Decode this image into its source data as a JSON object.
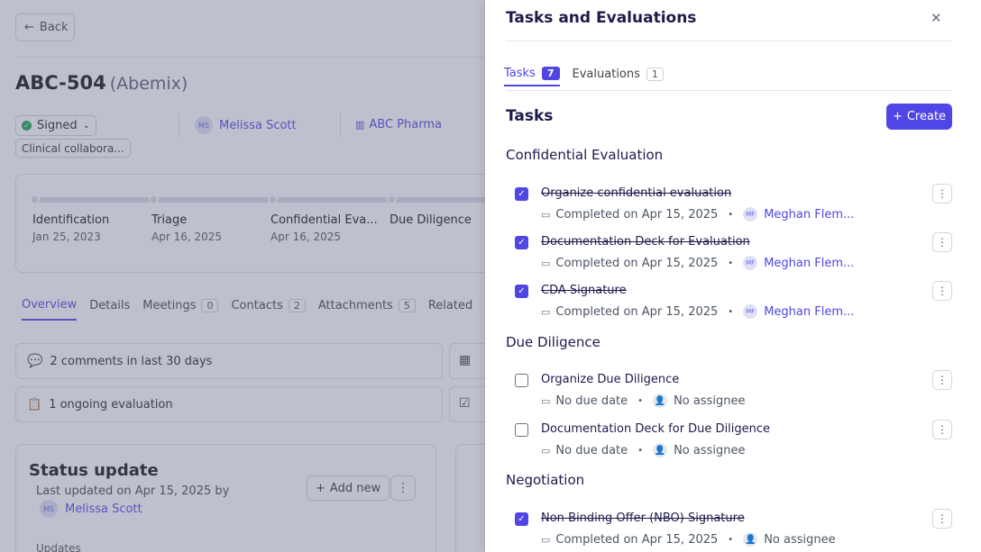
{
  "background": {
    "back_label": "Back",
    "title": "ABC-504",
    "subtitle": "(Abemix)",
    "status": "Signed",
    "owner_initials": "MS",
    "owner_name": "Melissa Scott",
    "company": "ABC Pharma",
    "tag": "Clinical collabora...",
    "stages": [
      {
        "name": "Identification",
        "date": "Jan 25, 2023"
      },
      {
        "name": "Triage",
        "date": "Apr 16, 2025"
      },
      {
        "name": "Confidential Eva...",
        "date": "Apr 16, 2025"
      },
      {
        "name": "Due Diligence",
        "date": ""
      }
    ],
    "tabs": [
      {
        "label": "Overview",
        "count": ""
      },
      {
        "label": "Details",
        "count": ""
      },
      {
        "label": "Meetings",
        "count": "0"
      },
      {
        "label": "Contacts",
        "count": "2"
      },
      {
        "label": "Attachments",
        "count": "5"
      },
      {
        "label": "Related",
        "count": ""
      }
    ],
    "comments_text": "2 comments in last 30 days",
    "evaluations_text": "1 ongoing evaluation",
    "status_update": {
      "title": "Status update",
      "last_updated": "Last updated on Apr 15, 2025  by",
      "author_initials": "MS",
      "author": "Melissa Scott",
      "add_new": "Add new",
      "updates_label": "Updates"
    }
  },
  "drawer": {
    "title": "Tasks and Evaluations",
    "tabs": [
      {
        "label": "Tasks",
        "count": "7"
      },
      {
        "label": "Evaluations",
        "count": "1"
      }
    ],
    "tasks_heading": "Tasks",
    "create_label": "Create",
    "sections": [
      {
        "title": "Confidential Evaluation",
        "tasks": [
          {
            "name": "Organize confidential evaluation",
            "done": true,
            "date": "Completed on Apr 15, 2025",
            "assignee_initials": "MF",
            "assignee": "Meghan Flem..."
          },
          {
            "name": "Documentation Deck for Evaluation",
            "done": true,
            "date": "Completed on Apr 15, 2025",
            "assignee_initials": "MF",
            "assignee": "Meghan Flem..."
          },
          {
            "name": "CDA Signature",
            "done": true,
            "date": "Completed on Apr 15, 2025",
            "assignee_initials": "MF",
            "assignee": "Meghan Flem..."
          }
        ]
      },
      {
        "title": "Due Diligence",
        "tasks": [
          {
            "name": "Organize Due Diligence",
            "done": false,
            "date": "No due date",
            "assignee_initials": "",
            "assignee": "No assignee"
          },
          {
            "name": "Documentation Deck for Due Diligence",
            "done": false,
            "date": "No due date",
            "assignee_initials": "",
            "assignee": "No assignee"
          }
        ]
      },
      {
        "title": "Negotiation",
        "tasks": [
          {
            "name": "Non-Binding Offer (NBO) Signature",
            "done": true,
            "date": "Completed on Apr 15, 2025",
            "assignee_initials": "",
            "assignee": "No assignee"
          }
        ]
      }
    ]
  },
  "colors": {
    "accent": "#4f46e5",
    "success": "#16a34a"
  }
}
